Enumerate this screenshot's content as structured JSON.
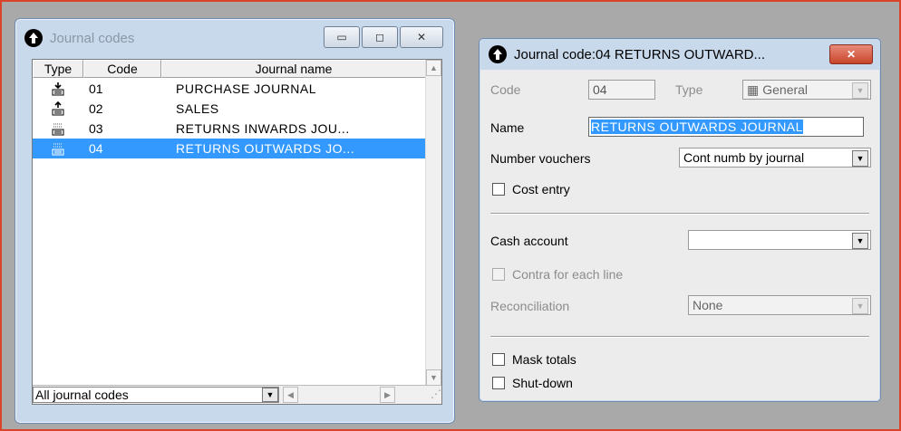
{
  "list_window": {
    "title": "Journal codes",
    "columns": [
      "Type",
      "Code",
      "Journal name"
    ],
    "rows": [
      {
        "code": "01",
        "name": "PURCHASE JOURNAL",
        "icon": "purchase-journal-icon",
        "selected": false
      },
      {
        "code": "02",
        "name": "SALES",
        "icon": "sales-journal-icon",
        "selected": false
      },
      {
        "code": "03",
        "name": "RETURNS INWARDS JOU...",
        "icon": "general-journal-icon",
        "selected": false
      },
      {
        "code": "04",
        "name": "RETURNS OUTWARDS JO...",
        "icon": "general-journal-icon",
        "selected": true
      }
    ],
    "filter_value": "All journal codes"
  },
  "detail_window": {
    "title": "Journal code:04 RETURNS OUTWARD...",
    "code_label": "Code",
    "code_value": "04",
    "type_label": "Type",
    "type_value": "General",
    "name_label": "Name",
    "name_value": "RETURNS OUTWARDS JOURNAL",
    "number_vouchers_label": "Number vouchers",
    "number_vouchers_value": "Cont numb by journal",
    "cost_entry_label": "Cost entry",
    "cash_account_label": "Cash account",
    "cash_account_value": "",
    "contra_label": "Contra for each line",
    "reconciliation_label": "Reconciliation",
    "reconciliation_value": "None",
    "mask_totals_label": "Mask totals",
    "shutdown_label": "Shut-down"
  },
  "colors": {
    "selection": "#3399ff",
    "frame_border": "#d9442b",
    "title_bar": "#c9d9ec"
  }
}
